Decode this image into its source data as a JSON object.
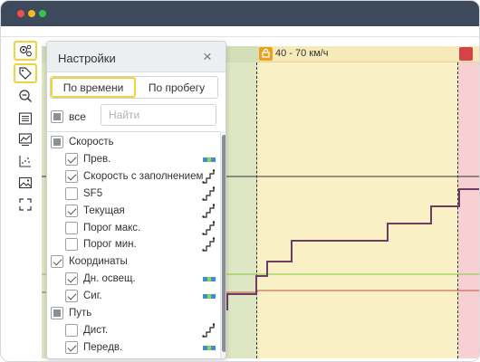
{
  "panel": {
    "title": "Настройки",
    "close": "×",
    "tabs": [
      "По времени",
      "По пробегу"
    ],
    "all_label": "все",
    "search_placeholder": "Найти",
    "items": [
      {
        "label": "Скорость",
        "state": "partial",
        "level": 0,
        "legend": "none"
      },
      {
        "label": "Прев.",
        "state": "checked",
        "level": 1,
        "legend": "bar"
      },
      {
        "label": "Скорость с заполнением",
        "state": "checked",
        "level": 1,
        "legend": "step"
      },
      {
        "label": "SF5",
        "state": "unchecked",
        "level": 1,
        "legend": "step"
      },
      {
        "label": "Текущая",
        "state": "checked",
        "level": 1,
        "legend": "step"
      },
      {
        "label": "Порог макс.",
        "state": "unchecked",
        "level": 1,
        "legend": "step"
      },
      {
        "label": "Порог мин.",
        "state": "unchecked",
        "level": 1,
        "legend": "step"
      },
      {
        "label": "Координаты",
        "state": "checked",
        "level": 0,
        "legend": "none"
      },
      {
        "label": "Дн. освещ.",
        "state": "checked",
        "level": 1,
        "legend": "bar"
      },
      {
        "label": "Сиг.",
        "state": "checked",
        "level": 1,
        "legend": "bar"
      },
      {
        "label": "Путь",
        "state": "partial",
        "level": 0,
        "legend": "none"
      },
      {
        "label": "Дист.",
        "state": "unchecked",
        "level": 1,
        "legend": "step"
      },
      {
        "label": "Передв.",
        "state": "checked",
        "level": 1,
        "legend": "bar"
      }
    ]
  },
  "chart": {
    "zone_label": "40 - 70 км/ч",
    "colors": {
      "green_zone": "#dfe6c4",
      "yellow_zone": "#faf0c6",
      "red_zone": "#f7d0d3",
      "speed_line": "#6e3d63",
      "green_line": "#7ecb3a",
      "red_line": "#c0533c",
      "dark_line": "#333333"
    }
  },
  "toolbar": {
    "icons": [
      "settings-icon",
      "tag-icon",
      "zoom-out-icon",
      "list-icon",
      "chart-settings-icon",
      "scatter-icon",
      "image-icon",
      "fullscreen-icon"
    ]
  }
}
